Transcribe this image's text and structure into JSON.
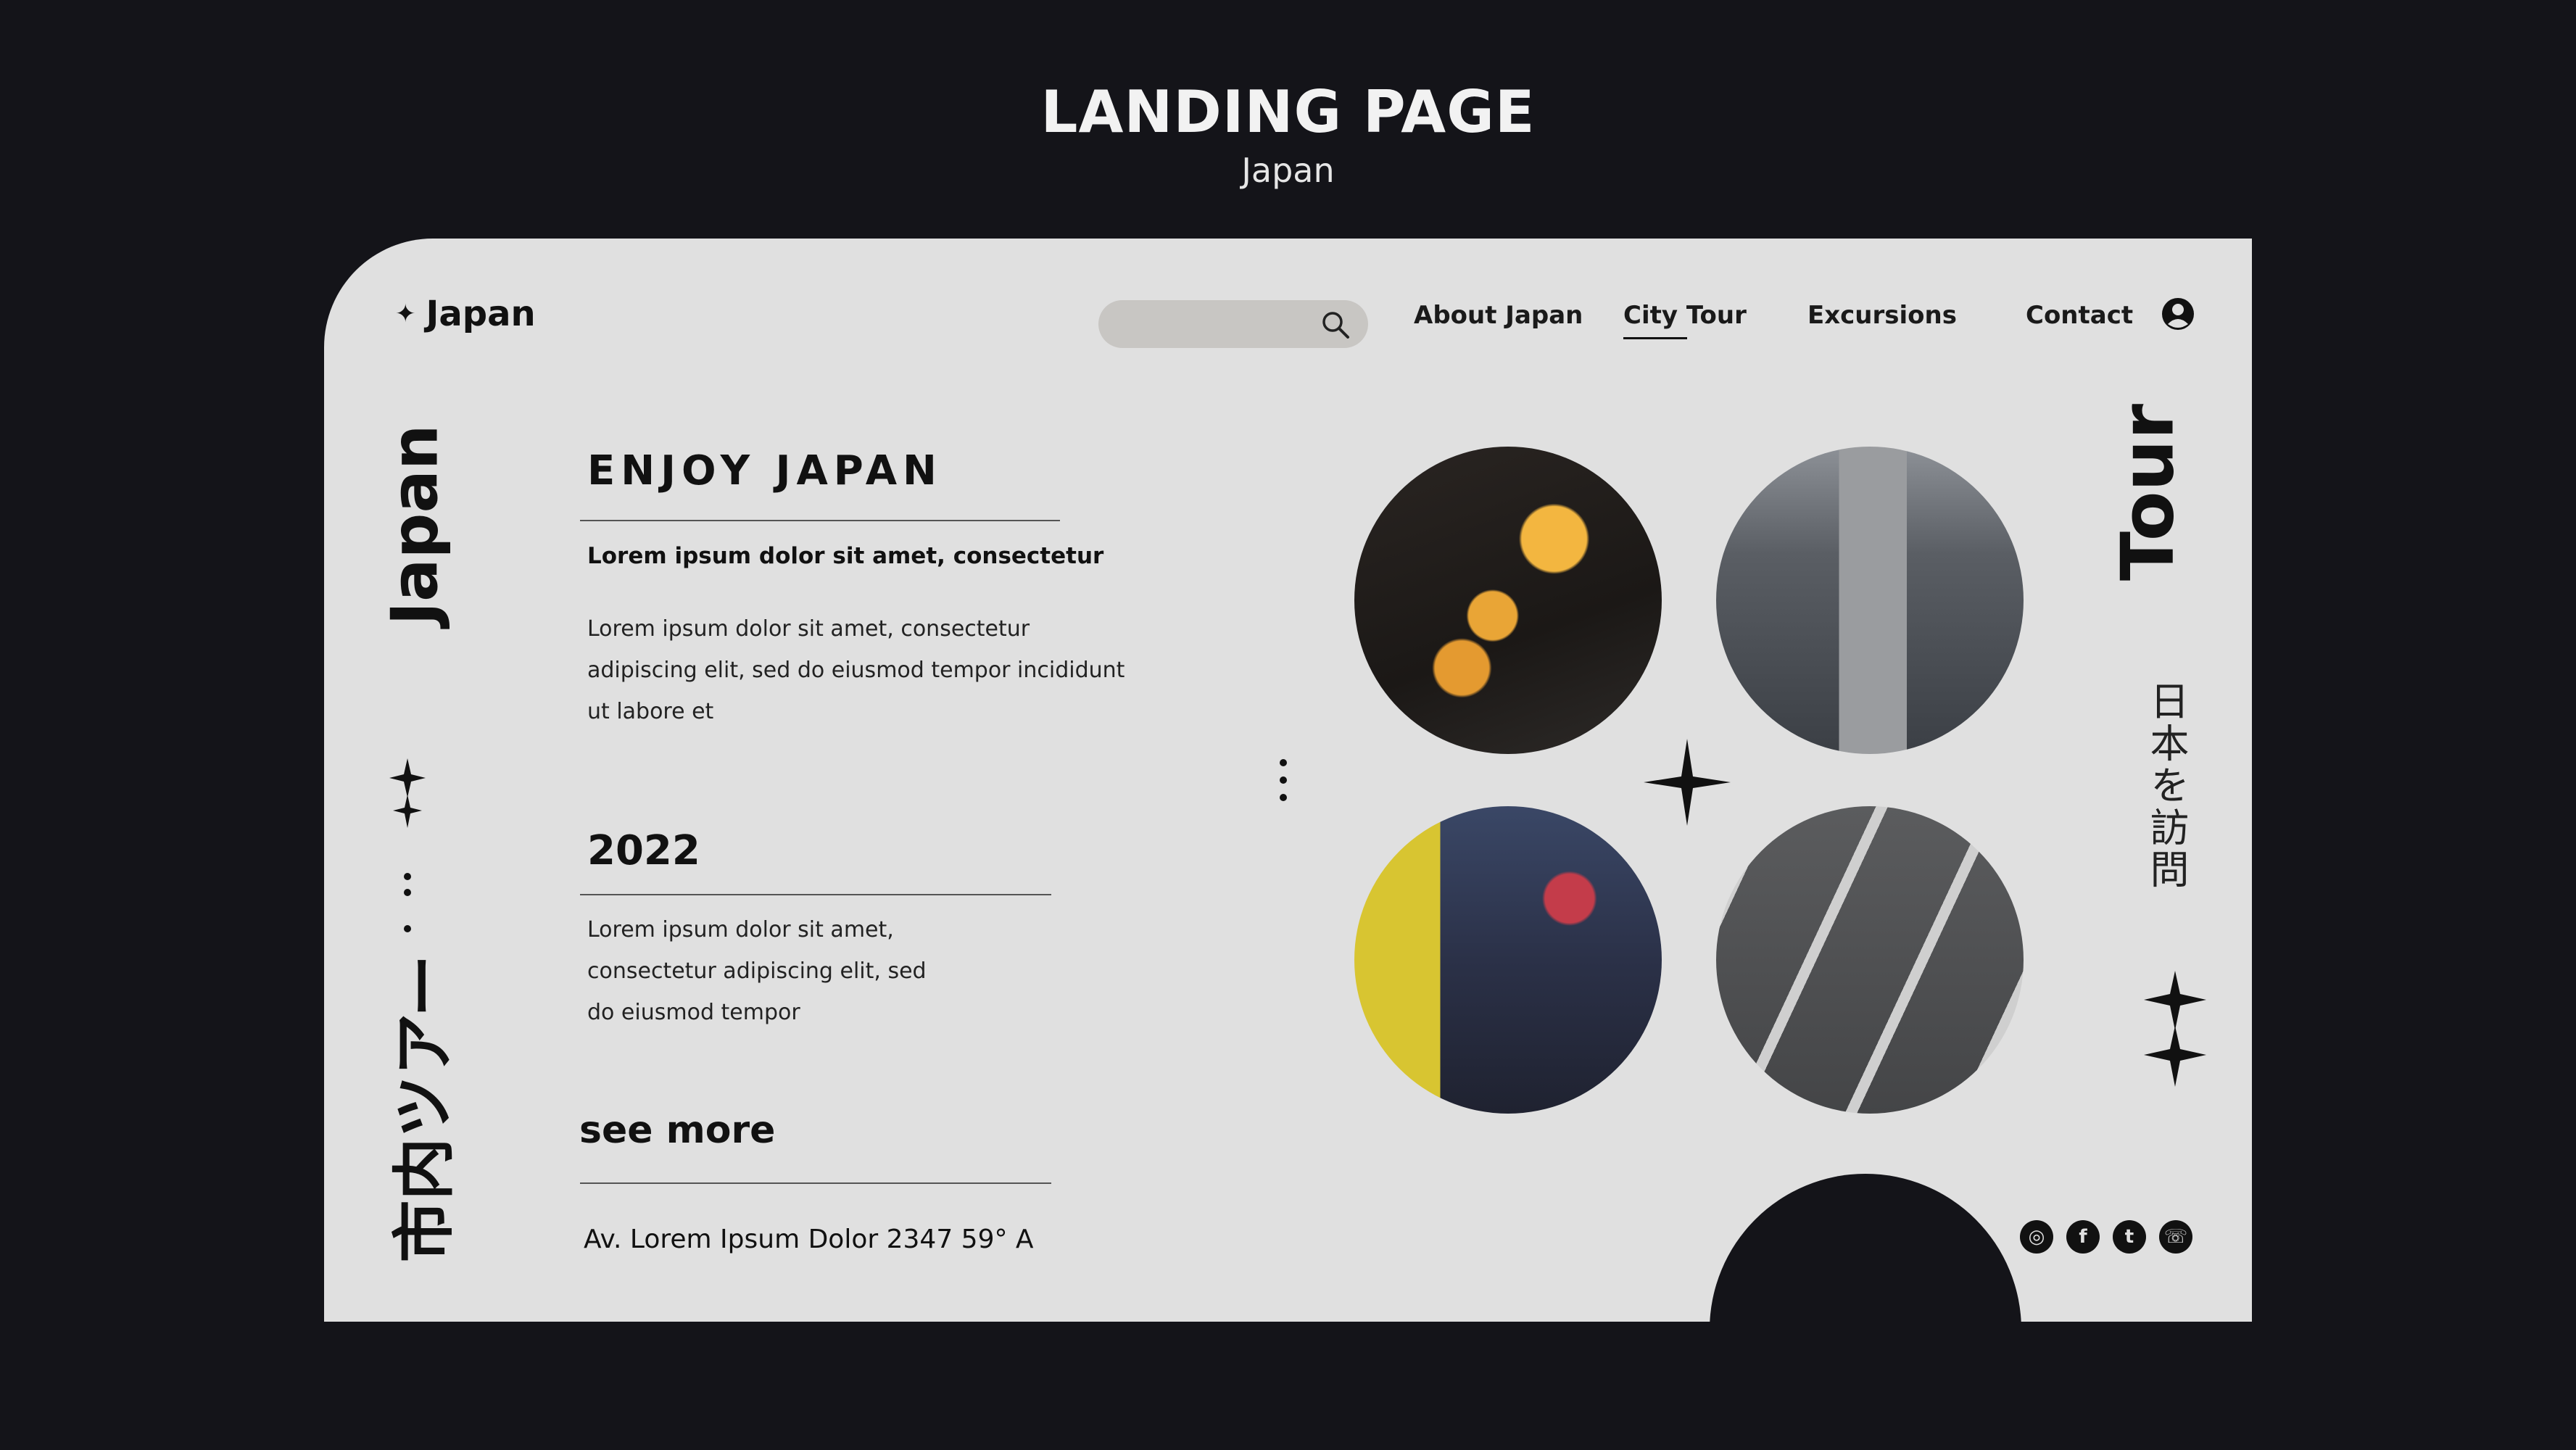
{
  "header": {
    "title": "LANDING PAGE",
    "subtitle": "Japan"
  },
  "site": {
    "logo": "Japan",
    "logo_icon": "sparkle-icon",
    "search": {
      "placeholder": "",
      "icon": "search-icon"
    },
    "nav": [
      "About Japan",
      "City Tour",
      "Excursions",
      "Contact"
    ],
    "active_nav": "City Tour",
    "user_icon": "user-circle-icon"
  },
  "side": {
    "left_vertical": "Japan",
    "left_kana": "市内ツアー",
    "right_vertical": "Tour",
    "right_kanji": "日本を訪問"
  },
  "content": {
    "heading": "ENJOY JAPAN",
    "subheading": "Lorem ipsum dolor sit amet, consectetur",
    "paragraph_lines": [
      "Lorem ipsum dolor sit amet, consectetur",
      "adipiscing elit, sed do eiusmod tempor incididunt",
      "ut labore et"
    ],
    "year": "2022",
    "year_lines": [
      "Lorem ipsum dolor sit amet,",
      "consectetur adipiscing elit, sed",
      "do eiusmod tempor"
    ],
    "see_more": "see more",
    "address": "Av. Lorem Ipsum Dolor 2347 59° A"
  },
  "gallery": {
    "photos": [
      "lanterns-photo",
      "street-crossing-photo",
      "night-street-photo",
      "road-markings-photo"
    ]
  },
  "social": [
    "instagram-icon",
    "facebook-icon",
    "twitter-icon",
    "whatsapp-icon"
  ],
  "colors": {
    "background": "#141419",
    "card": "#e0e0e0",
    "text": "#111111",
    "search": "#c8c6c3"
  }
}
